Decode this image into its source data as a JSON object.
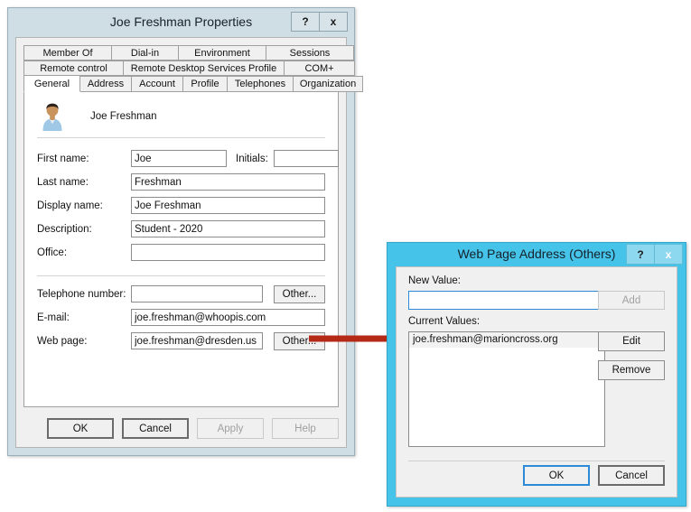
{
  "properties_window": {
    "title": "Joe Freshman Properties",
    "help_button": "?",
    "close_button": "x",
    "tab_rows": [
      [
        {
          "label": "Member Of",
          "width": 98,
          "active": false
        },
        {
          "label": "Dial-in",
          "width": 75,
          "active": false
        },
        {
          "label": "Environment",
          "width": 98,
          "active": false
        },
        {
          "label": "Sessions",
          "width": 98,
          "active": false
        }
      ],
      [
        {
          "label": "Remote control",
          "width": 111,
          "active": false
        },
        {
          "label": "Remote Desktop Services Profile",
          "width": 179,
          "active": false
        },
        {
          "label": "COM+",
          "width": 79,
          "active": false
        }
      ],
      [
        {
          "label": "General",
          "width": 63,
          "active": true
        },
        {
          "label": "Address",
          "width": 58,
          "active": false
        },
        {
          "label": "Account",
          "width": 58,
          "active": false
        },
        {
          "label": "Profile",
          "width": 50,
          "active": false
        },
        {
          "label": "Telephones",
          "width": 74,
          "active": false
        },
        {
          "label": "Organization",
          "width": 78,
          "active": false
        }
      ]
    ],
    "avatar_icon": "user-avatar-icon",
    "header_name": "Joe Freshman",
    "fields": {
      "first_name_label": "First name:",
      "first_name_value": "Joe",
      "initials_label": "Initials:",
      "initials_value": "",
      "last_name_label": "Last name:",
      "last_name_value": "Freshman",
      "display_name_label": "Display name:",
      "display_name_value": "Joe Freshman",
      "description_label": "Description:",
      "description_value": "Student - 2020",
      "office_label": "Office:",
      "office_value": "",
      "telephone_label": "Telephone number:",
      "telephone_value": "",
      "telephone_other_button": "Other...",
      "email_label": "E-mail:",
      "email_value": "joe.freshman@whoopis.com",
      "webpage_label": "Web page:",
      "webpage_value": "joe.freshman@dresden.us",
      "webpage_other_button": "Other..."
    },
    "footer_buttons": [
      {
        "label": "OK",
        "enabled": true,
        "default": true
      },
      {
        "label": "Cancel",
        "enabled": true,
        "default": false
      },
      {
        "label": "Apply",
        "enabled": false,
        "default": false
      },
      {
        "label": "Help",
        "enabled": false,
        "default": false
      }
    ]
  },
  "web_page_dialog": {
    "title": "Web Page Address (Others)",
    "help_button": "?",
    "close_button": "x",
    "new_value_label": "New Value:",
    "new_value_text": "",
    "add_button": "Add",
    "add_button_enabled": false,
    "current_values_label": "Current Values:",
    "current_values": [
      "joe.freshman@marioncross.org"
    ],
    "edit_button": "Edit",
    "remove_button": "Remove",
    "footer_buttons": [
      {
        "label": "OK",
        "focused": true
      },
      {
        "label": "Cancel",
        "focused": false
      }
    ]
  },
  "annotation": {
    "arrow_color": "#b52a16",
    "description": "arrow from Web page Other button to Web Page Address dialog"
  },
  "colors": {
    "props_chrome": "#cfdde4",
    "dialog_chrome": "#45c3e8",
    "close_red": "#c0504d",
    "focus_blue": "#2c8ad6"
  }
}
